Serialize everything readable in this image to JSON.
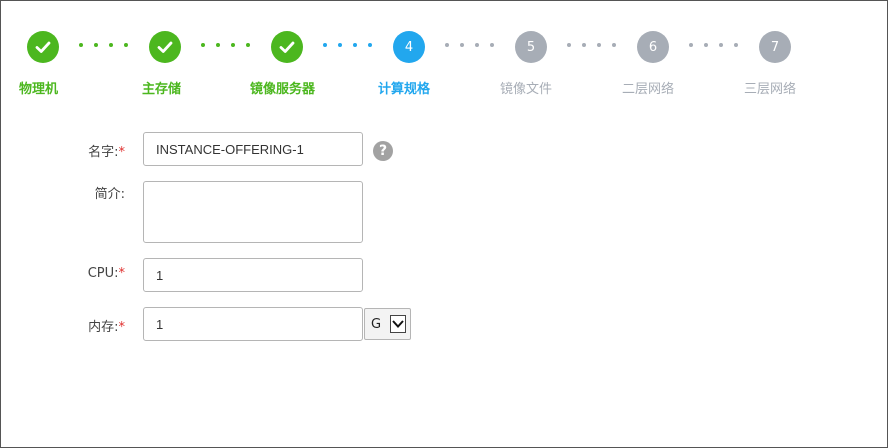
{
  "steps": [
    {
      "label": "物理机",
      "state": "done",
      "icon": "check-icon"
    },
    {
      "label": "主存储",
      "state": "done",
      "icon": "check-icon"
    },
    {
      "label": "镜像服务器",
      "state": "done",
      "icon": "check-icon"
    },
    {
      "label": "计算规格",
      "number": "4",
      "state": "active"
    },
    {
      "label": "镜像文件",
      "number": "5",
      "state": "todo"
    },
    {
      "label": "二层网络",
      "number": "6",
      "state": "todo"
    },
    {
      "label": "三层网络",
      "number": "7",
      "state": "todo"
    }
  ],
  "colors": {
    "done": "#4cb71f",
    "active": "#22a7ee",
    "todo": "#a7adb6",
    "required": "#e0302f"
  },
  "form": {
    "name": {
      "label": "名字:",
      "required_mark": "*",
      "value": "INSTANCE-OFFERING-1",
      "help_icon": "question-circle-icon",
      "help_glyph": "?"
    },
    "description": {
      "label": "简介:",
      "value": ""
    },
    "cpu": {
      "label": "CPU:",
      "required_mark": "*",
      "value": "1"
    },
    "memory": {
      "label": "内存:",
      "required_mark": "*",
      "value": "1",
      "unit": "G"
    }
  }
}
